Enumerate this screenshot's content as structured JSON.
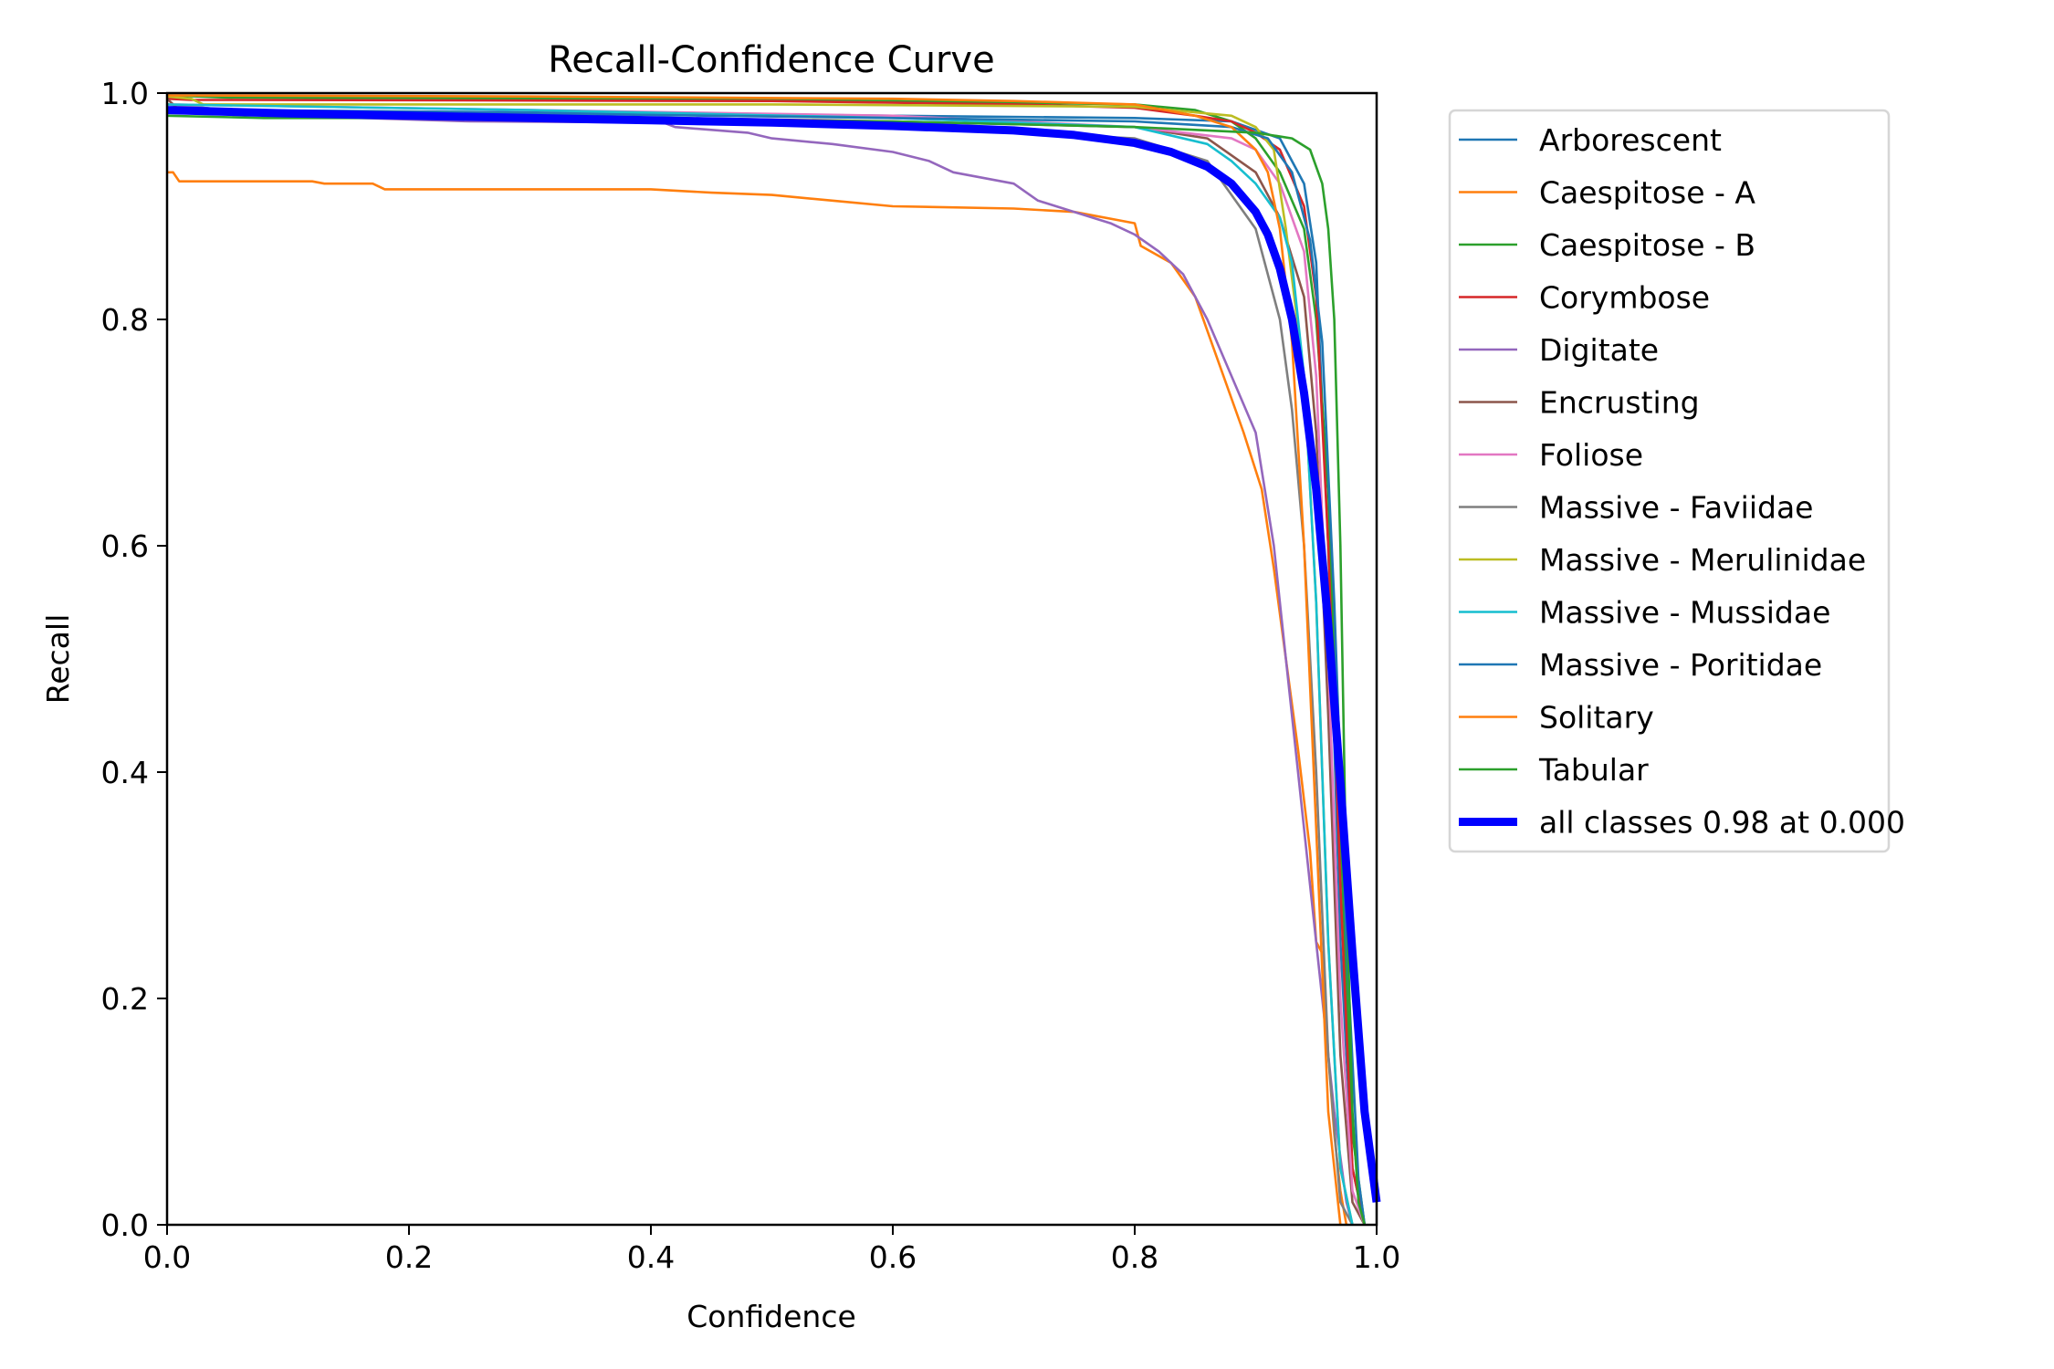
{
  "chart_data": {
    "type": "line",
    "title": "Recall-Confidence Curve",
    "xlabel": "Confidence",
    "ylabel": "Recall",
    "xlim": [
      0,
      1
    ],
    "ylim": [
      0,
      1
    ],
    "xticks": [
      "0.0",
      "0.2",
      "0.4",
      "0.6",
      "0.8",
      "1.0"
    ],
    "yticks": [
      "0.0",
      "0.2",
      "0.4",
      "0.6",
      "0.8",
      "1.0"
    ],
    "xtick_values": [
      0,
      0.2,
      0.4,
      0.6,
      0.8,
      1.0
    ],
    "ytick_values": [
      0,
      0.2,
      0.4,
      0.6,
      0.8,
      1.0
    ],
    "grid": false,
    "legend_position": "outside-top-right",
    "series": [
      {
        "name": "Arborescent",
        "color": "#1f77b4",
        "bold": false,
        "x": [
          0,
          0.05,
          0.3,
          0.6,
          0.8,
          0.88,
          0.92,
          0.94,
          0.95,
          0.96,
          0.97,
          0.98,
          0.99
        ],
        "y": [
          0.99,
          0.985,
          0.983,
          0.98,
          0.978,
          0.975,
          0.96,
          0.92,
          0.85,
          0.6,
          0.25,
          0.05,
          0.0
        ]
      },
      {
        "name": "Caespitose - A",
        "color": "#ff7f0e",
        "bold": false,
        "x": [
          0,
          0.005,
          0.01,
          0.12,
          0.13,
          0.17,
          0.18,
          0.4,
          0.45,
          0.5,
          0.55,
          0.6,
          0.7,
          0.75,
          0.8,
          0.805,
          0.83,
          0.85,
          0.87,
          0.89,
          0.905,
          0.915,
          0.925,
          0.935,
          0.945,
          0.95,
          0.955,
          0.96,
          0.965,
          0.97,
          0.975
        ],
        "y": [
          0.93,
          0.93,
          0.922,
          0.922,
          0.92,
          0.92,
          0.915,
          0.915,
          0.912,
          0.91,
          0.905,
          0.9,
          0.898,
          0.895,
          0.885,
          0.865,
          0.85,
          0.82,
          0.76,
          0.7,
          0.65,
          0.58,
          0.5,
          0.42,
          0.33,
          0.25,
          0.24,
          0.15,
          0.08,
          0.03,
          0.0
        ]
      },
      {
        "name": "Caespitose - B",
        "color": "#2ca02c",
        "bold": false,
        "x": [
          0,
          0.05,
          0.4,
          0.6,
          0.8,
          0.85,
          0.88,
          0.9,
          0.92,
          0.94,
          0.95,
          0.96,
          0.97,
          0.98,
          0.99
        ],
        "y": [
          0.998,
          0.996,
          0.995,
          0.993,
          0.99,
          0.985,
          0.975,
          0.96,
          0.93,
          0.88,
          0.8,
          0.65,
          0.35,
          0.08,
          0.0
        ]
      },
      {
        "name": "Corymbose",
        "color": "#d62728",
        "bold": false,
        "x": [
          0,
          0.02,
          0.5,
          0.7,
          0.8,
          0.85,
          0.88,
          0.9,
          0.92,
          0.94,
          0.95,
          0.96,
          0.97,
          0.98,
          0.99
        ],
        "y": [
          0.995,
          0.994,
          0.993,
          0.99,
          0.987,
          0.98,
          0.975,
          0.965,
          0.95,
          0.9,
          0.82,
          0.6,
          0.3,
          0.05,
          0.0
        ]
      },
      {
        "name": "Digitate",
        "color": "#9467bd",
        "bold": false,
        "x": [
          0,
          0.1,
          0.25,
          0.41,
          0.42,
          0.48,
          0.5,
          0.55,
          0.6,
          0.63,
          0.65,
          0.7,
          0.72,
          0.75,
          0.78,
          0.8,
          0.82,
          0.84,
          0.86,
          0.88,
          0.9,
          0.915,
          0.925,
          0.935,
          0.945,
          0.955,
          0.965,
          0.975,
          0.98
        ],
        "y": [
          0.99,
          0.98,
          0.975,
          0.974,
          0.97,
          0.965,
          0.96,
          0.955,
          0.948,
          0.94,
          0.93,
          0.92,
          0.905,
          0.895,
          0.885,
          0.875,
          0.86,
          0.84,
          0.8,
          0.75,
          0.7,
          0.6,
          0.5,
          0.4,
          0.3,
          0.2,
          0.1,
          0.02,
          0.0
        ]
      },
      {
        "name": "Encrusting",
        "color": "#8c564b",
        "bold": false,
        "x": [
          0,
          0.01,
          0.04,
          0.3,
          0.6,
          0.8,
          0.86,
          0.9,
          0.92,
          0.94,
          0.95,
          0.96,
          0.97,
          0.98,
          0.99
        ],
        "y": [
          0.995,
          0.985,
          0.983,
          0.98,
          0.975,
          0.97,
          0.96,
          0.93,
          0.89,
          0.82,
          0.7,
          0.45,
          0.15,
          0.02,
          0.0
        ]
      },
      {
        "name": "Foliose",
        "color": "#e377c2",
        "bold": false,
        "x": [
          0,
          0.3,
          0.6,
          0.8,
          0.88,
          0.9,
          0.92,
          0.94,
          0.95,
          0.96,
          0.97,
          0.98,
          0.99
        ],
        "y": [
          0.99,
          0.985,
          0.98,
          0.97,
          0.96,
          0.95,
          0.92,
          0.86,
          0.75,
          0.5,
          0.2,
          0.03,
          0.0
        ]
      },
      {
        "name": "Massive - Faviidae",
        "color": "#7f7f7f",
        "bold": false,
        "x": [
          0,
          0.3,
          0.6,
          0.8,
          0.86,
          0.9,
          0.92,
          0.93,
          0.94,
          0.95,
          0.96,
          0.97,
          0.98
        ],
        "y": [
          0.985,
          0.978,
          0.97,
          0.96,
          0.94,
          0.88,
          0.8,
          0.72,
          0.6,
          0.4,
          0.15,
          0.02,
          0.0
        ]
      },
      {
        "name": "Massive - Merulinidae",
        "color": "#bcbd22",
        "bold": false,
        "x": [
          0,
          0.02,
          0.03,
          0.5,
          0.8,
          0.88,
          0.9,
          0.915,
          0.925,
          0.94,
          0.95,
          0.96,
          0.97,
          0.98
        ],
        "y": [
          0.997,
          0.995,
          0.99,
          0.99,
          0.988,
          0.98,
          0.97,
          0.95,
          0.88,
          0.75,
          0.55,
          0.25,
          0.05,
          0.0
        ]
      },
      {
        "name": "Massive - Mussidae",
        "color": "#17becf",
        "bold": false,
        "x": [
          0,
          0.3,
          0.6,
          0.8,
          0.86,
          0.88,
          0.9,
          0.92,
          0.93,
          0.94,
          0.95,
          0.96,
          0.97,
          0.98
        ],
        "y": [
          0.99,
          0.985,
          0.978,
          0.97,
          0.955,
          0.94,
          0.92,
          0.89,
          0.85,
          0.75,
          0.55,
          0.25,
          0.05,
          0.0
        ]
      },
      {
        "name": "Massive - Poritidae",
        "color": "#1f77b4",
        "bold": false,
        "x": [
          0,
          0.3,
          0.6,
          0.8,
          0.88,
          0.91,
          0.93,
          0.945,
          0.955,
          0.965,
          0.975,
          0.985,
          0.99
        ],
        "y": [
          0.985,
          0.982,
          0.978,
          0.975,
          0.97,
          0.96,
          0.93,
          0.87,
          0.78,
          0.55,
          0.25,
          0.04,
          0.0
        ]
      },
      {
        "name": "Solitary",
        "color": "#ff7f0e",
        "bold": false,
        "x": [
          0,
          0.3,
          0.6,
          0.7,
          0.8,
          0.85,
          0.88,
          0.9,
          0.91,
          0.92,
          0.93,
          0.94,
          0.95,
          0.96,
          0.97
        ],
        "y": [
          0.998,
          0.997,
          0.995,
          0.993,
          0.99,
          0.98,
          0.97,
          0.95,
          0.93,
          0.88,
          0.78,
          0.6,
          0.35,
          0.1,
          0.0
        ]
      },
      {
        "name": "Tabular",
        "color": "#2ca02c",
        "bold": false,
        "x": [
          0,
          0.08,
          0.3,
          0.6,
          0.8,
          0.9,
          0.93,
          0.945,
          0.955,
          0.96,
          0.965,
          0.97,
          0.975,
          0.98,
          0.985,
          0.99
        ],
        "y": [
          0.98,
          0.978,
          0.978,
          0.975,
          0.97,
          0.965,
          0.96,
          0.95,
          0.92,
          0.88,
          0.8,
          0.6,
          0.3,
          0.1,
          0.02,
          0.0
        ]
      },
      {
        "name": "all classes 0.98 at 0.000",
        "color": "#0000ff",
        "bold": true,
        "x": [
          0,
          0.1,
          0.2,
          0.3,
          0.4,
          0.5,
          0.6,
          0.7,
          0.75,
          0.8,
          0.83,
          0.86,
          0.88,
          0.9,
          0.91,
          0.92,
          0.93,
          0.94,
          0.95,
          0.96,
          0.97,
          0.98,
          0.99,
          1.0
        ],
        "y": [
          0.985,
          0.982,
          0.98,
          0.978,
          0.976,
          0.974,
          0.971,
          0.967,
          0.963,
          0.956,
          0.948,
          0.935,
          0.92,
          0.895,
          0.875,
          0.845,
          0.8,
          0.735,
          0.65,
          0.53,
          0.39,
          0.24,
          0.1,
          0.02
        ]
      }
    ]
  }
}
